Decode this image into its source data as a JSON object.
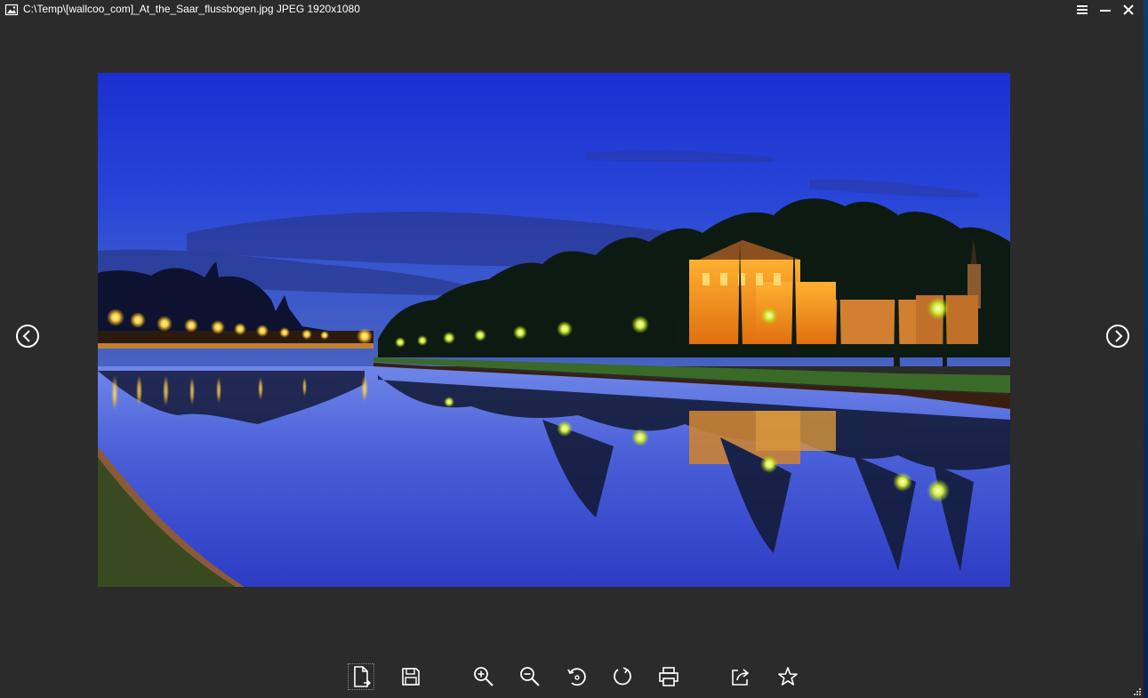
{
  "window": {
    "title": "C:\\Temp\\[wallcoo_com]_At_the_Saar_flussbogen.jpg JPEG 1920x1080",
    "controls": [
      {
        "name": "menu-icon"
      },
      {
        "name": "minimize-icon"
      },
      {
        "name": "close-icon"
      }
    ]
  },
  "viewer": {
    "prev_icon": "chevron-left-circle-icon",
    "next_icon": "chevron-right-circle-icon"
  },
  "toolbar": {
    "tools": [
      {
        "name": "open-file-icon"
      },
      {
        "name": "save-icon"
      },
      {
        "name": "zoom-in-icon"
      },
      {
        "name": "zoom-out-icon"
      },
      {
        "name": "rotate-left-icon"
      },
      {
        "name": "rotate-right-icon"
      },
      {
        "name": "print-icon"
      },
      {
        "name": "share-icon"
      },
      {
        "name": "favorite-star-icon"
      }
    ]
  },
  "colors": {
    "background": "#2b2b2b",
    "foreground": "#ffffff",
    "sky": "#1c34c8",
    "water": "#3342c8",
    "lights": "#ffb020"
  }
}
